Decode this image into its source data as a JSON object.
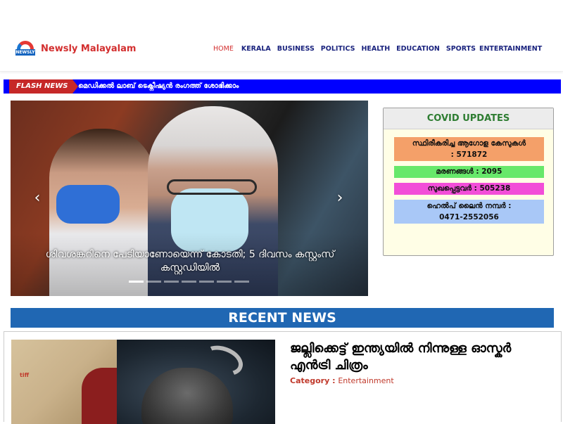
{
  "brand": {
    "logo_text": "NEWSLY",
    "name": "Newsly Malayalam"
  },
  "nav": {
    "items": [
      "HOME",
      "KERALA",
      "BUSINESS",
      "POLITICS",
      "HEALTH",
      "EDUCATION",
      "SPORTS",
      "ENTERTAINMENT"
    ],
    "active": "HOME"
  },
  "flash": {
    "label": "FLASH NEWS",
    "text": "മെഡിക്കൽ ലാബ് ടെക്നീഷ്യൻ രംഗത്ത് ശോഭിക്കാം"
  },
  "slider": {
    "caption": "ശിവശങ്കറിനെ പേടിയാണോയെന്ന് കോടതി; 5 ദിവസം കസ്റ്റംസ് കസ്റ്റഡിയിൽ",
    "prev_icon": "chevron-left-icon",
    "next_icon": "chevron-right-icon",
    "slide_count": 7,
    "active_slide": 1
  },
  "covid": {
    "title": "COVID UPDATES",
    "stats": [
      {
        "label": "സ്ഥിരീകരിച്ച ആഗോള കേസുകൾ",
        "value": "571872",
        "color": "#f4a069"
      },
      {
        "label": "മരണങ്ങൾ",
        "value": "2095",
        "color": "#67e86a"
      },
      {
        "label": "സുഖപ്പെട്ടവർ",
        "value": "505238",
        "color": "#f24ed8"
      },
      {
        "label": "ഹെൽപ് ലൈൻ നമ്പർ",
        "value": "0471-2552056",
        "color": "#a9c8f7"
      }
    ]
  },
  "recent": {
    "title": "RECENT NEWS"
  },
  "article": {
    "title": "ജല്ലിക്കെട്ട് ഇന്ത്യയിൽ നിന്നുള്ള ഓസ്കർ എൻട്രി ചിത്രം",
    "category_label": "Category",
    "category_value": "Entertainment",
    "thumb_text": "tiff"
  },
  "colors": {
    "brand_red": "#d32f2f",
    "nav_blue": "#1a237e",
    "flash_bg": "#0000ff",
    "flash_label_bg": "#c62828",
    "recent_bg": "#2067b3",
    "covid_title": "#2e7d32"
  }
}
